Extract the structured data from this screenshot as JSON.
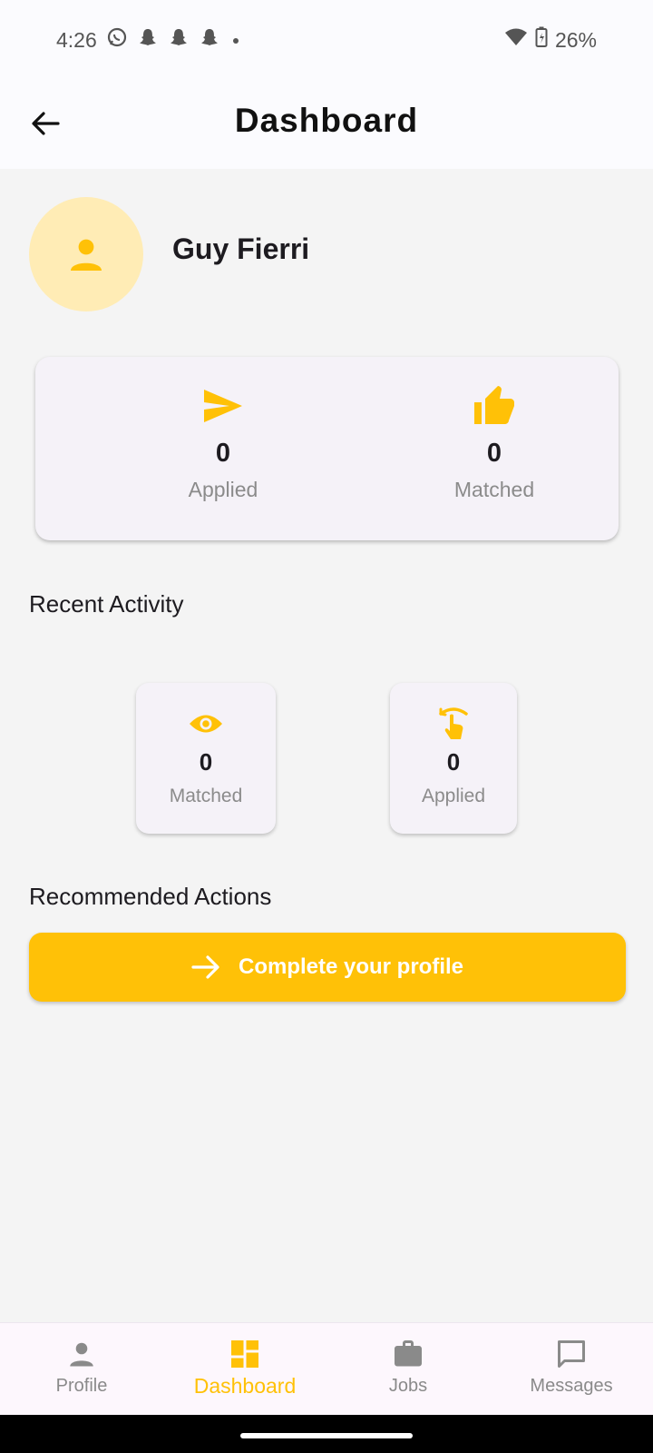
{
  "status_bar": {
    "time": "4:26",
    "notification_icons": [
      "whatsapp-icon",
      "snapchat-icon",
      "snapchat-icon",
      "snapchat-icon",
      "dot-icon"
    ],
    "battery": "26%"
  },
  "app_bar": {
    "title": "Dashboard"
  },
  "profile": {
    "name": "Guy Fierri"
  },
  "stats": {
    "applied": {
      "value": "0",
      "label": "Applied",
      "icon": "send-icon"
    },
    "matched": {
      "value": "0",
      "label": "Matched",
      "icon": "thumbs-up-icon"
    }
  },
  "recent_activity": {
    "title": "Recent Activity",
    "cards": [
      {
        "value": "0",
        "label": "Matched",
        "icon": "eye-icon"
      },
      {
        "value": "0",
        "label": "Applied",
        "icon": "touch-icon"
      }
    ]
  },
  "recommended": {
    "title": "Recommended Actions",
    "action_label": "Complete your profile"
  },
  "bottom_nav": {
    "items": [
      {
        "label": "Profile",
        "icon": "person-icon",
        "active": false
      },
      {
        "label": "Dashboard",
        "icon": "dashboard-icon",
        "active": true
      },
      {
        "label": "Jobs",
        "icon": "briefcase-icon",
        "active": false
      },
      {
        "label": "Messages",
        "icon": "message-icon",
        "active": false
      }
    ]
  },
  "colors": {
    "accent": "#ffc107",
    "avatar_bg": "#ffecb5",
    "card_bg": "#f5f2f8",
    "page_bg": "#f4f4f4"
  }
}
